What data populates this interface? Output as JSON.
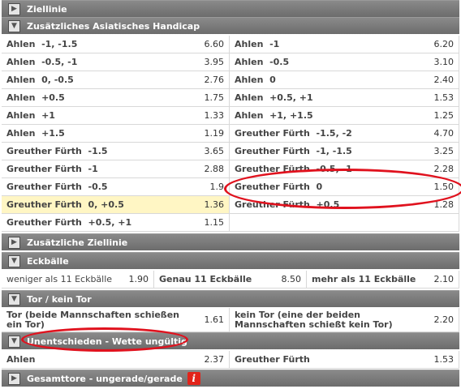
{
  "sections": {
    "ziellinie": "Ziellinie",
    "asian_handicap": "Zusätzliches Asiatisches Handicap",
    "zusaetzliche_ziellinie": "Zusätzliche Ziellinie",
    "eckbaelle": "Eckbälle",
    "tor_kein_tor": "Tor / kein Tor",
    "unentschieden": "Unentschieden - Wette ungültig",
    "gesamttore": "Gesamttore - ungerade/gerade"
  },
  "handicap": {
    "left": [
      {
        "label": "Ahlen  -1, -1.5",
        "odds": "6.60"
      },
      {
        "label": "Ahlen  -0.5, -1",
        "odds": "3.95"
      },
      {
        "label": "Ahlen  0, -0.5",
        "odds": "2.76"
      },
      {
        "label": "Ahlen  +0.5",
        "odds": "1.75"
      },
      {
        "label": "Ahlen  +1",
        "odds": "1.33"
      },
      {
        "label": "Ahlen  +1.5",
        "odds": "1.19"
      },
      {
        "label": "Greuther Fürth  -1.5",
        "odds": "3.65"
      },
      {
        "label": "Greuther Fürth  -1",
        "odds": "2.88"
      },
      {
        "label": "Greuther Fürth  -0.5",
        "odds": "1.9"
      },
      {
        "label": "Greuther Fürth  0, +0.5",
        "odds": "1.36"
      },
      {
        "label": "Greuther Fürth  +0.5, +1",
        "odds": "1.15"
      }
    ],
    "right": [
      {
        "label": "Ahlen  -1",
        "odds": "6.20"
      },
      {
        "label": "Ahlen  -0.5",
        "odds": "3.10"
      },
      {
        "label": "Ahlen  0",
        "odds": "2.40"
      },
      {
        "label": "Ahlen  +0.5, +1",
        "odds": "1.53"
      },
      {
        "label": "Ahlen  +1, +1.5",
        "odds": "1.25"
      },
      {
        "label": "Greuther Fürth  -1.5, -2",
        "odds": "4.70"
      },
      {
        "label": "Greuther Fürth  -1, -1.5",
        "odds": "3.25"
      },
      {
        "label": "Greuther Fürth  -0.5, -1",
        "odds": "2.28"
      },
      {
        "label": "Greuther Fürth  0",
        "odds": "1.50"
      },
      {
        "label": "Greuther Fürth  +0.5",
        "odds": "1.28"
      }
    ]
  },
  "eckbaelle": [
    {
      "label": "weniger als 11 Eckbälle",
      "odds": "1.90"
    },
    {
      "label": "Genau 11 Eckbälle",
      "odds": "8.50"
    },
    {
      "label": "mehr als 11 Eckbälle",
      "odds": "2.10"
    }
  ],
  "tor": [
    {
      "label": "Tor (beide Mannschaften schießen ein Tor)",
      "odds": "1.61"
    },
    {
      "label": "kein Tor (eine der beiden Mannschaften schießt kein Tor)",
      "odds": "2.20"
    }
  ],
  "draw_no_bet": [
    {
      "label": "Ahlen",
      "odds": "2.37"
    },
    {
      "label": "Greuther Fürth",
      "odds": "1.53"
    }
  ],
  "colors": {
    "header": "#7a7a7a",
    "highlight": "#fff6c4",
    "annotation": "#e0121e"
  }
}
